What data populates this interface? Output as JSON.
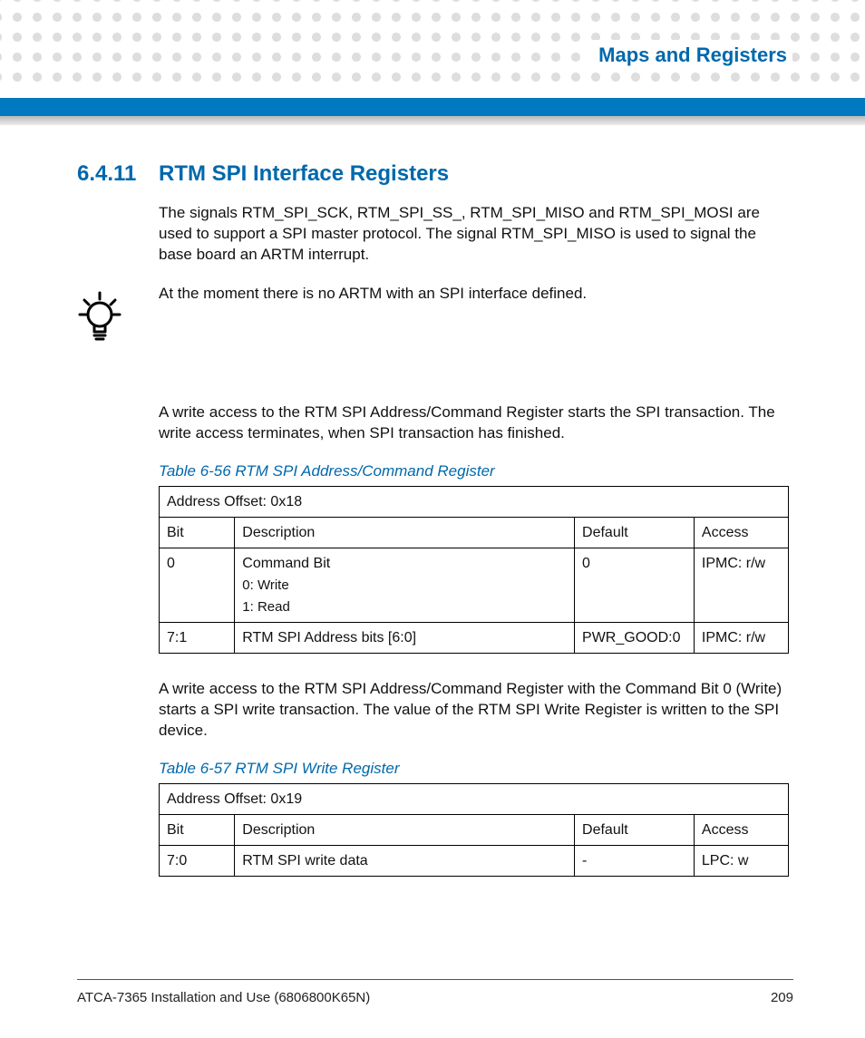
{
  "header": {
    "chapter": "Maps and Registers"
  },
  "section": {
    "number": "6.4.11",
    "title": "RTM SPI Interface Registers",
    "para1": "The signals RTM_SPI_SCK, RTM_SPI_SS_, RTM_SPI_MISO and RTM_SPI_MOSI are used to support a SPI master protocol. The signal RTM_SPI_MISO is used to signal the base board an ARTM interrupt.",
    "note": "At the moment there is no ARTM with an SPI interface defined.",
    "para2": "A write access to the RTM SPI Address/Command Register starts the SPI transaction. The write access terminates, when SPI transaction has finished.",
    "para3": "A write access to the RTM SPI Address/Command Register with the Command Bit 0 (Write) starts a SPI write transaction. The value of the RTM SPI Write Register is written to the SPI device."
  },
  "table1": {
    "caption": "Table 6-56 RTM SPI Address/Command Register",
    "addr": "Address Offset: 0x18",
    "head": {
      "bit": "Bit",
      "desc": "Description",
      "def": "Default",
      "acc": "Access"
    },
    "rows": [
      {
        "bit": "0",
        "desc": "Command Bit",
        "sub1": "0: Write",
        "sub2": "1: Read",
        "def": "0",
        "acc": "IPMC: r/w"
      },
      {
        "bit": "7:1",
        "desc": "RTM SPI Address bits [6:0]",
        "def": "PWR_GOOD:0",
        "acc": "IPMC: r/w"
      }
    ]
  },
  "table2": {
    "caption": "Table 6-57 RTM SPI Write Register",
    "addr": "Address Offset: 0x19",
    "head": {
      "bit": "Bit",
      "desc": "Description",
      "def": "Default",
      "acc": "Access"
    },
    "rows": [
      {
        "bit": "7:0",
        "desc": "RTM SPI write data",
        "def": "-",
        "acc": "LPC: w"
      }
    ]
  },
  "footer": {
    "doc": "ATCA-7365 Installation and Use (6806800K65N)",
    "page": "209"
  }
}
